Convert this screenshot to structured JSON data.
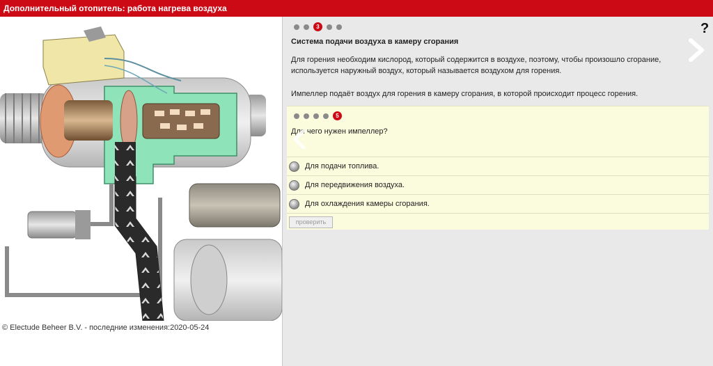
{
  "header": {
    "title": "Дополнительный отопитель: работа нагрева воздуха"
  },
  "left": {
    "copyright": "© Electude Beheer B.V. - последние изменения:2020-05-24"
  },
  "content": {
    "pager": {
      "active_page": "3"
    },
    "help_label": "?",
    "section_title": "Система подачи воздуха в камеру сгорания",
    "paragraph1": "Для горения необходим кислород, который содержится в воздухе, поэтому, чтобы произошло сгорание, используется наружный воздух, который называется воздухом для горения.",
    "paragraph2": "Импеллер подаёт воздух для горения в камеру сгорания, в которой происходит процесс горения."
  },
  "quiz": {
    "pager": {
      "active_page": "5"
    },
    "question": "Для чего нужен импеллер?",
    "options": [
      "Для подачи топлива.",
      "Для передвижения воздуха.",
      "Для охлаждения камеры сгорания."
    ],
    "check_label": "проверить"
  },
  "colors": {
    "brand_red": "#cc0a16",
    "quiz_background": "#fbfbde"
  }
}
